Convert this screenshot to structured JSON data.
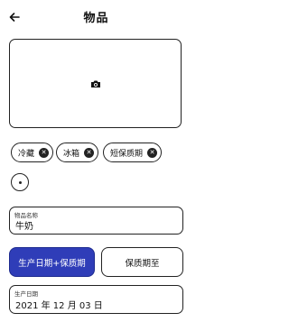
{
  "header": {
    "title": "物品",
    "back_icon": "arrow-left-icon"
  },
  "photo": {
    "icon": "camera-icon"
  },
  "tags": [
    {
      "label": "冷藏"
    },
    {
      "label": "冰箱"
    },
    {
      "label": "短保质期"
    }
  ],
  "add_tag": {
    "icon": "plus-icon"
  },
  "name_field": {
    "label": "物品名称",
    "value": "牛奶"
  },
  "mode_buttons": {
    "primary_label": "生产日期+保质期",
    "secondary_label": "保质期至",
    "accent_color": "#2f3db8"
  },
  "date_field": {
    "label": "生产日期",
    "value": "2021 年 12 月 03 日"
  }
}
